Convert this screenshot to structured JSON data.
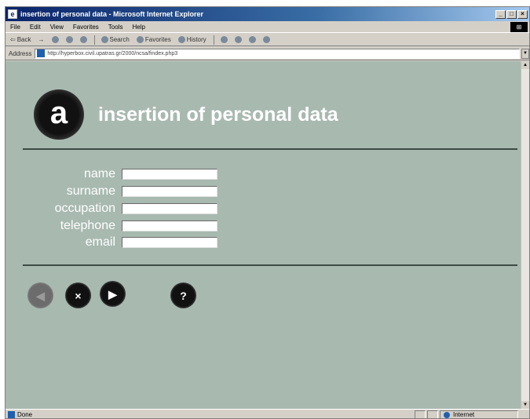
{
  "window": {
    "title": "insertion of personal data - Microsoft Internet Explorer",
    "controls": {
      "minimize": "_",
      "maximize": "□",
      "close": "×"
    }
  },
  "menubar": {
    "items": [
      "File",
      "Edit",
      "View",
      "Favorites",
      "Tools",
      "Help"
    ]
  },
  "toolbar": {
    "back": "Back",
    "forward": "→",
    "stop_icon": "stop-icon",
    "refresh_icon": "refresh-icon",
    "home_icon": "home-icon",
    "search": "Search",
    "favorites": "Favorites",
    "history": "History"
  },
  "address": {
    "label": "Address",
    "url": "http://hyperbox.civil.upatras.gr/2000/ncsa/findex.php3"
  },
  "page": {
    "logo_letter": "a",
    "title": "insertion of personal data",
    "fields": [
      {
        "label": "name",
        "value": ""
      },
      {
        "label": "surname",
        "value": ""
      },
      {
        "label": "occupation",
        "value": ""
      },
      {
        "label": "telephone",
        "value": ""
      },
      {
        "label": "email",
        "value": ""
      }
    ],
    "buttons": [
      {
        "name": "back",
        "glyph": "◀",
        "enabled": false
      },
      {
        "name": "clear",
        "glyph": "×",
        "enabled": true
      },
      {
        "name": "next",
        "glyph": "▶",
        "enabled": true
      },
      {
        "name": "help",
        "glyph": "?",
        "enabled": true
      }
    ]
  },
  "status": {
    "text": "Done",
    "zone": "Internet"
  },
  "colors": {
    "page_background": "#a8b9b0",
    "rule": "#3c4a44",
    "title_bar": "#0a246a"
  }
}
